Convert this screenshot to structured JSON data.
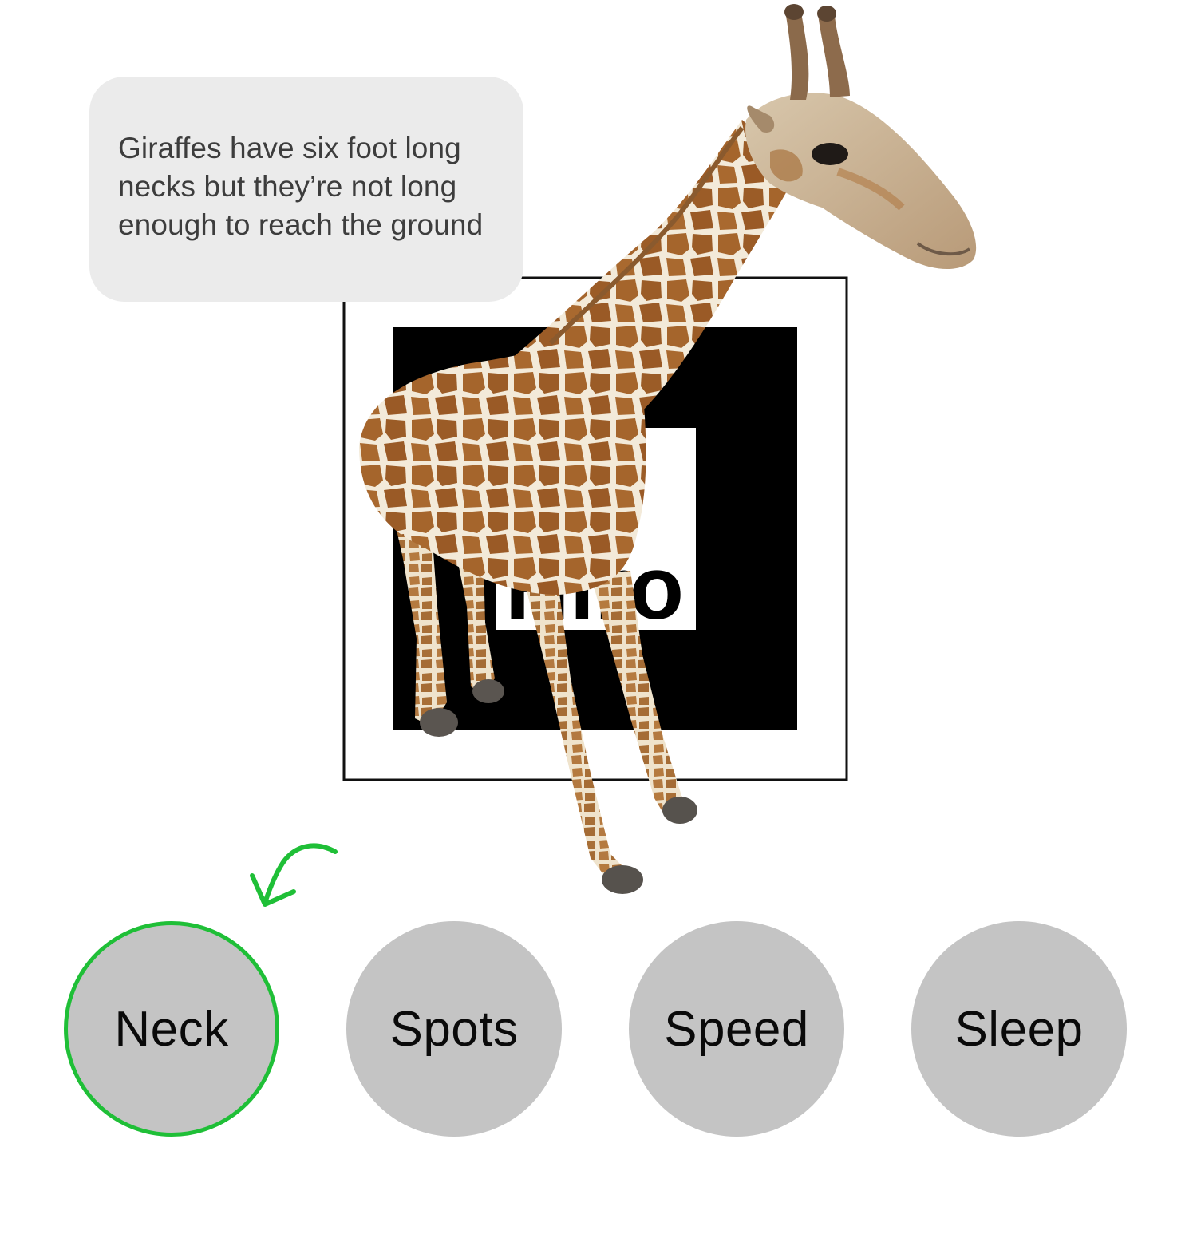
{
  "info": {
    "text": "Giraffes have six foot long necks but they’re not long enough to reach the ground"
  },
  "ar_marker": {
    "marker_text": "Hiro"
  },
  "topics": [
    {
      "label": "Neck",
      "selected": true
    },
    {
      "label": "Spots",
      "selected": false
    },
    {
      "label": "Speed",
      "selected": false
    },
    {
      "label": "Sleep",
      "selected": false
    }
  ],
  "colors": {
    "selected_ring": "#1fbf37",
    "button_fill": "#c4c4c4",
    "card_fill": "#ebebeb",
    "arrow": "#1fbf37"
  },
  "icons": {
    "hint": "curved-arrow-icon"
  }
}
